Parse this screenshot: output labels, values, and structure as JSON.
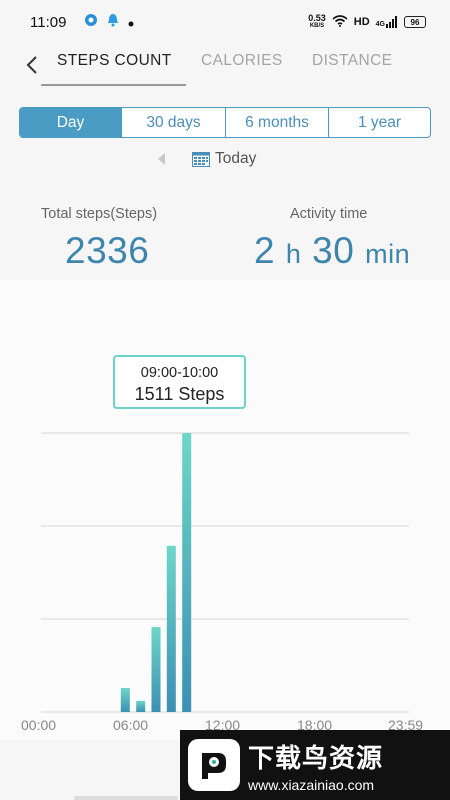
{
  "status_bar": {
    "time": "11:09",
    "net_speed": "0.53",
    "net_unit": "KB/S",
    "hd": "HD",
    "signal": "4G",
    "battery": "96"
  },
  "nav": {
    "tabs": [
      {
        "label": "STEPS COUNT",
        "active": true
      },
      {
        "label": "CALORIES",
        "active": false
      },
      {
        "label": "DISTANCE",
        "active": false
      }
    ]
  },
  "range": {
    "options": [
      "Day",
      "30 days",
      "6 months",
      "1 year"
    ],
    "selected": "Day"
  },
  "date": {
    "label": "Today"
  },
  "stats": {
    "total_label": "Total steps(Steps)",
    "total_value": "2336",
    "activity_label": "Activity time",
    "activity_hours": "2",
    "hours_unit": "h",
    "activity_minutes": "30",
    "minutes_unit": "min"
  },
  "tooltip": {
    "range": "09:00-10:00",
    "value": "1511 Steps"
  },
  "chart_data": {
    "type": "bar",
    "x_labels": [
      "00:00",
      "06:00",
      "12:00",
      "18:00",
      "23:59"
    ],
    "hours": [
      5,
      6,
      7,
      8,
      9
    ],
    "values": [
      130,
      60,
      460,
      900,
      1511
    ],
    "ylim": [
      0,
      1511
    ],
    "grid": true,
    "colors": {
      "bar_top": "#6dd6c8",
      "bar_bottom": "#3c8fb3",
      "grid": "#d6d6d6"
    }
  },
  "watermark": {
    "title": "下载鸟资源",
    "url": "www.xiazainiao.com"
  },
  "colors": {
    "accent": "#4a9cc4",
    "value_text": "#3d85ad",
    "tooltip_border": "#6dd2c8"
  }
}
